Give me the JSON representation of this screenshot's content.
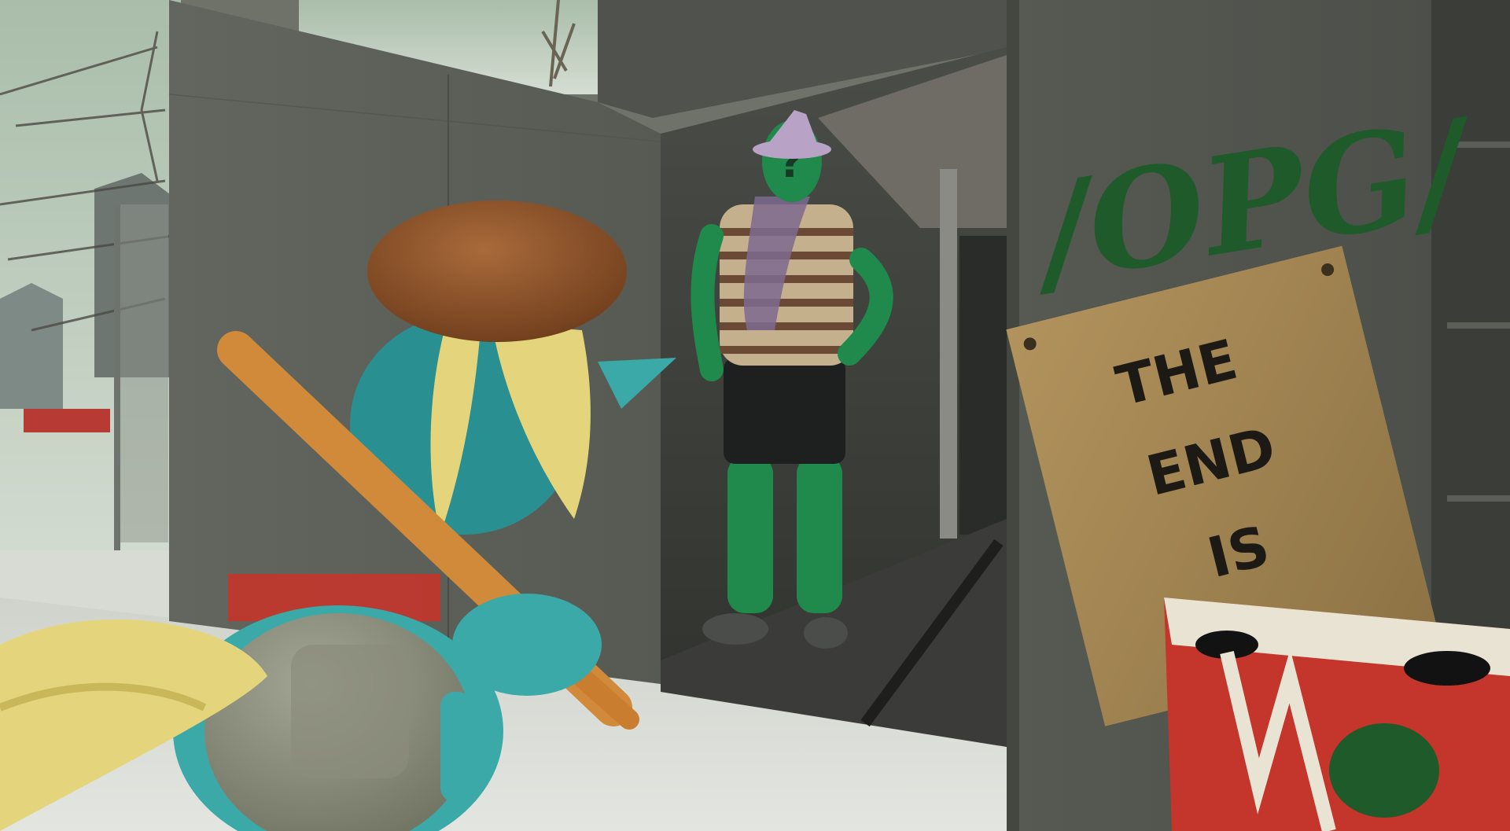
{
  "scene": {
    "description_label": "3D rendered scene",
    "graffiti_text": "/OPG/",
    "sign_lines": [
      "THE",
      "END",
      "IS",
      "..."
    ],
    "colors": {
      "sky": "#c9d6c6",
      "wall": "#5f625b",
      "wall_dark": "#3f423d",
      "floor": "#d9dcd6",
      "graffiti": "#1f5a2a",
      "sign": "#a88a55",
      "pony_body": "#3ba9a8",
      "pony_mane": "#e4d57c",
      "pony_hat": "#8a4f25",
      "bat": "#d08a3a",
      "figure_skin": "#1f8a4c",
      "figure_shirt_a": "#c5b08e",
      "figure_shirt_b": "#6b4a35",
      "figure_shorts": "#1e2020",
      "figure_hat": "#b8a3c6",
      "box_red": "#c4352b"
    }
  }
}
